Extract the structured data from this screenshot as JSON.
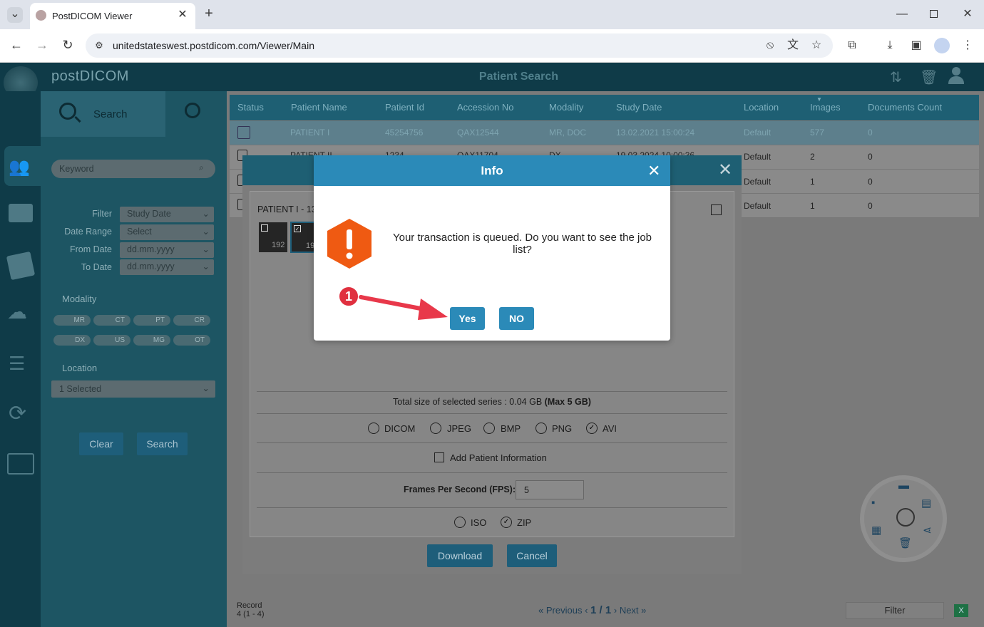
{
  "browser": {
    "tab_title": "PostDICOM Viewer",
    "url": "unitedstateswest.postdicom.com/Viewer/Main"
  },
  "app": {
    "logo": "postDICOM",
    "header_title": "Patient Search",
    "search_tab_label": "Search"
  },
  "filters": {
    "keyword_placeholder": "Keyword",
    "filter_label": "Filter",
    "filter_value": "Study Date",
    "date_range_label": "Date Range",
    "date_range_value": "Select",
    "from_date_label": "From Date",
    "from_date_value": "dd.mm.yyyy",
    "to_date_label": "To Date",
    "to_date_value": "dd.mm.yyyy",
    "modality_label": "Modality",
    "modalities": [
      "MR",
      "CT",
      "PT",
      "CR",
      "DX",
      "US",
      "MG",
      "OT"
    ],
    "location_label": "Location",
    "location_value": "1 Selected",
    "clear_label": "Clear",
    "search_label": "Search"
  },
  "table": {
    "headers": [
      "Status",
      "Patient Name",
      "Patient Id",
      "Accession No",
      "Modality",
      "Study Date",
      "Location",
      "Images",
      "Documents Count"
    ],
    "rows": [
      {
        "name": "PATIENT I",
        "id": "45254756",
        "acc": "QAX12544",
        "mod": "MR, DOC",
        "date": "13.02.2021 15:00:24",
        "loc": "Default",
        "images": "577",
        "docs": "0"
      },
      {
        "name": "PATIENT II",
        "id": "1234",
        "acc": "QAX11704",
        "mod": "DX",
        "date": "19.03.2024 10:00:36",
        "loc": "Default",
        "images": "2",
        "docs": "0"
      },
      {
        "name": "",
        "id": "",
        "acc": "",
        "mod": "",
        "date": "",
        "loc": "Default",
        "images": "1",
        "docs": "0"
      },
      {
        "name": "",
        "id": "",
        "acc": "",
        "mod": "",
        "date": "",
        "loc": "Default",
        "images": "1",
        "docs": "0"
      }
    ]
  },
  "download_modal": {
    "patient_label": "PATIENT I - 13",
    "thumb1_num": "192",
    "thumb2_num": "19",
    "total_size_prefix": "Total size of selected series : 0.04 GB",
    "total_size_max": "(Max 5 GB)",
    "formats": [
      "DICOM",
      "JPEG",
      "BMP",
      "PNG",
      "AVI"
    ],
    "add_patient_info_label": "Add Patient Information",
    "fps_label": "Frames Per Second (FPS):",
    "fps_value": "5",
    "packaging": [
      "ISO",
      "ZIP"
    ],
    "download_label": "Download",
    "cancel_label": "Cancel"
  },
  "info_dialog": {
    "title": "Info",
    "message": "Your transaction is queued. Do you want to see the job list?",
    "yes_label": "Yes",
    "no_label": "NO",
    "step_number": "1"
  },
  "footer": {
    "record_label": "Record",
    "record_value": "4 (1 - 4)",
    "previous_label": "Previous",
    "page_info": "1 / 1",
    "next_label": "Next",
    "filter_label": "Filter"
  }
}
